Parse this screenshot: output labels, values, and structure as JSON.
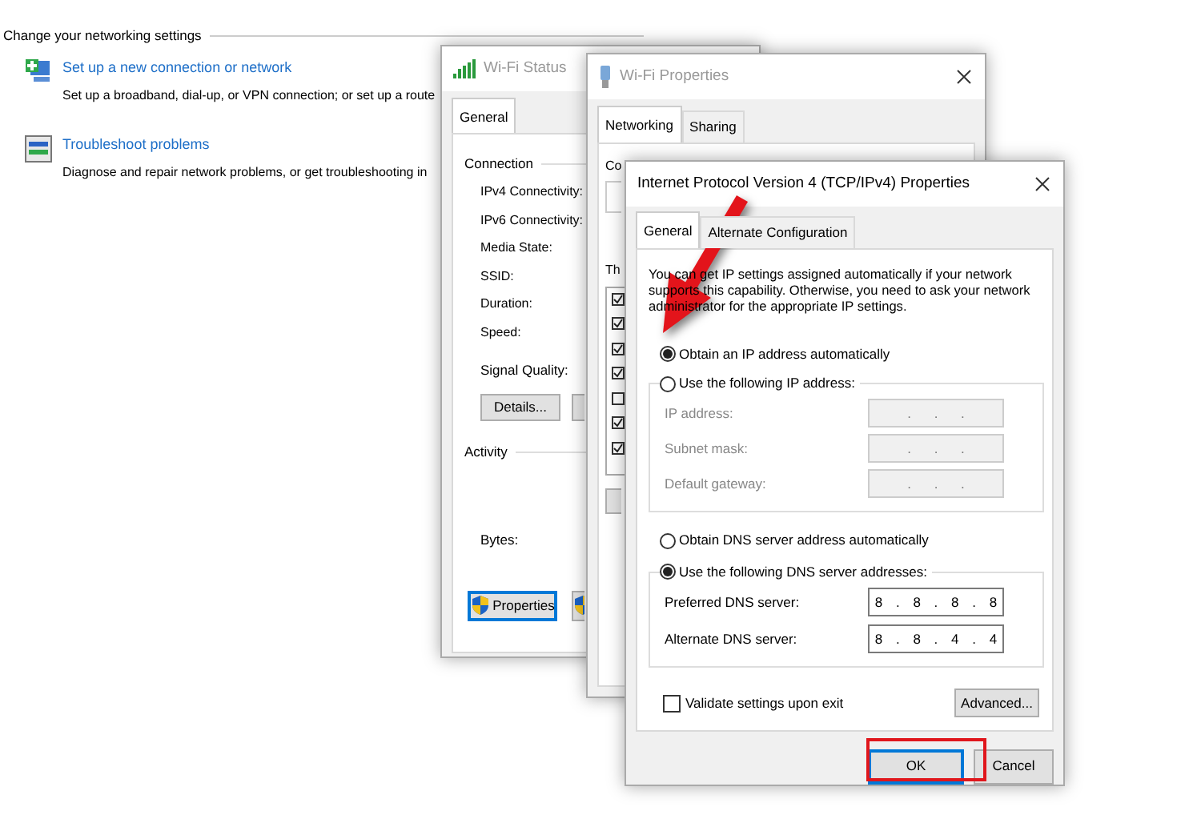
{
  "control_panel": {
    "heading": "Change your networking settings",
    "items": [
      {
        "kind": "connection",
        "link": "Set up a new connection or network",
        "description": "Set up a broadband, dial-up, or VPN connection; or set up a route"
      },
      {
        "kind": "troubleshoot",
        "link": "Troubleshoot problems",
        "description": "Diagnose and repair network problems, or get troubleshooting in"
      }
    ]
  },
  "wifi_status": {
    "title": "Wi-Fi Status",
    "tabs": [
      {
        "label": "General",
        "selected": true
      }
    ],
    "connection_heading": "Connection",
    "fields": [
      "IPv4 Connectivity:",
      "IPv6 Connectivity:",
      "Media State:",
      "SSID:",
      "Duration:",
      "Speed:"
    ],
    "signal_label": "Signal Quality:",
    "details_button": "Details...",
    "activity_heading": "Activity",
    "bytes_label": "Bytes:",
    "properties_button": "Properties"
  },
  "wifi_properties": {
    "title": "Wi-Fi Properties",
    "tabs": [
      {
        "label": "Networking",
        "selected": true
      },
      {
        "label": "Sharing",
        "selected": false
      }
    ],
    "connect_label": "Co",
    "components_label": "Th",
    "component_checks": [
      true,
      true,
      true,
      true,
      false,
      true,
      true
    ]
  },
  "ipv4_properties": {
    "title": "Internet Protocol Version 4 (TCP/IPv4) Properties",
    "tabs": [
      {
        "label": "General",
        "selected": true
      },
      {
        "label": "Alternate Configuration",
        "selected": false
      }
    ],
    "intro": "You can get IP settings assigned automatically if your network supports this capability. Otherwise, you need to ask your network administrator for the appropriate IP settings.",
    "ip_options": [
      {
        "label": "Obtain an IP address automatically",
        "selected": true
      },
      {
        "label": "Use the following IP address:",
        "selected": false
      }
    ],
    "ip_fields": [
      {
        "label": "IP address:",
        "value": ". . .",
        "disabled": true
      },
      {
        "label": "Subnet mask:",
        "value": ". . .",
        "disabled": true
      },
      {
        "label": "Default gateway:",
        "value": ". . .",
        "disabled": true
      }
    ],
    "dns_options": [
      {
        "label": "Obtain DNS server address automatically",
        "selected": false
      },
      {
        "label": "Use the following DNS server addresses:",
        "selected": true
      }
    ],
    "dns_fields": [
      {
        "label": "Preferred DNS server:",
        "value": "8 . 8 . 8 . 8",
        "disabled": false
      },
      {
        "label": "Alternate DNS server:",
        "value": "8 . 8 . 4 . 4",
        "disabled": false
      }
    ],
    "validate": {
      "label": "Validate settings upon exit",
      "checked": false
    },
    "advanced_button": "Advanced...",
    "ok_button": "OK",
    "cancel_button": "Cancel",
    "ok_highlighted": true
  }
}
